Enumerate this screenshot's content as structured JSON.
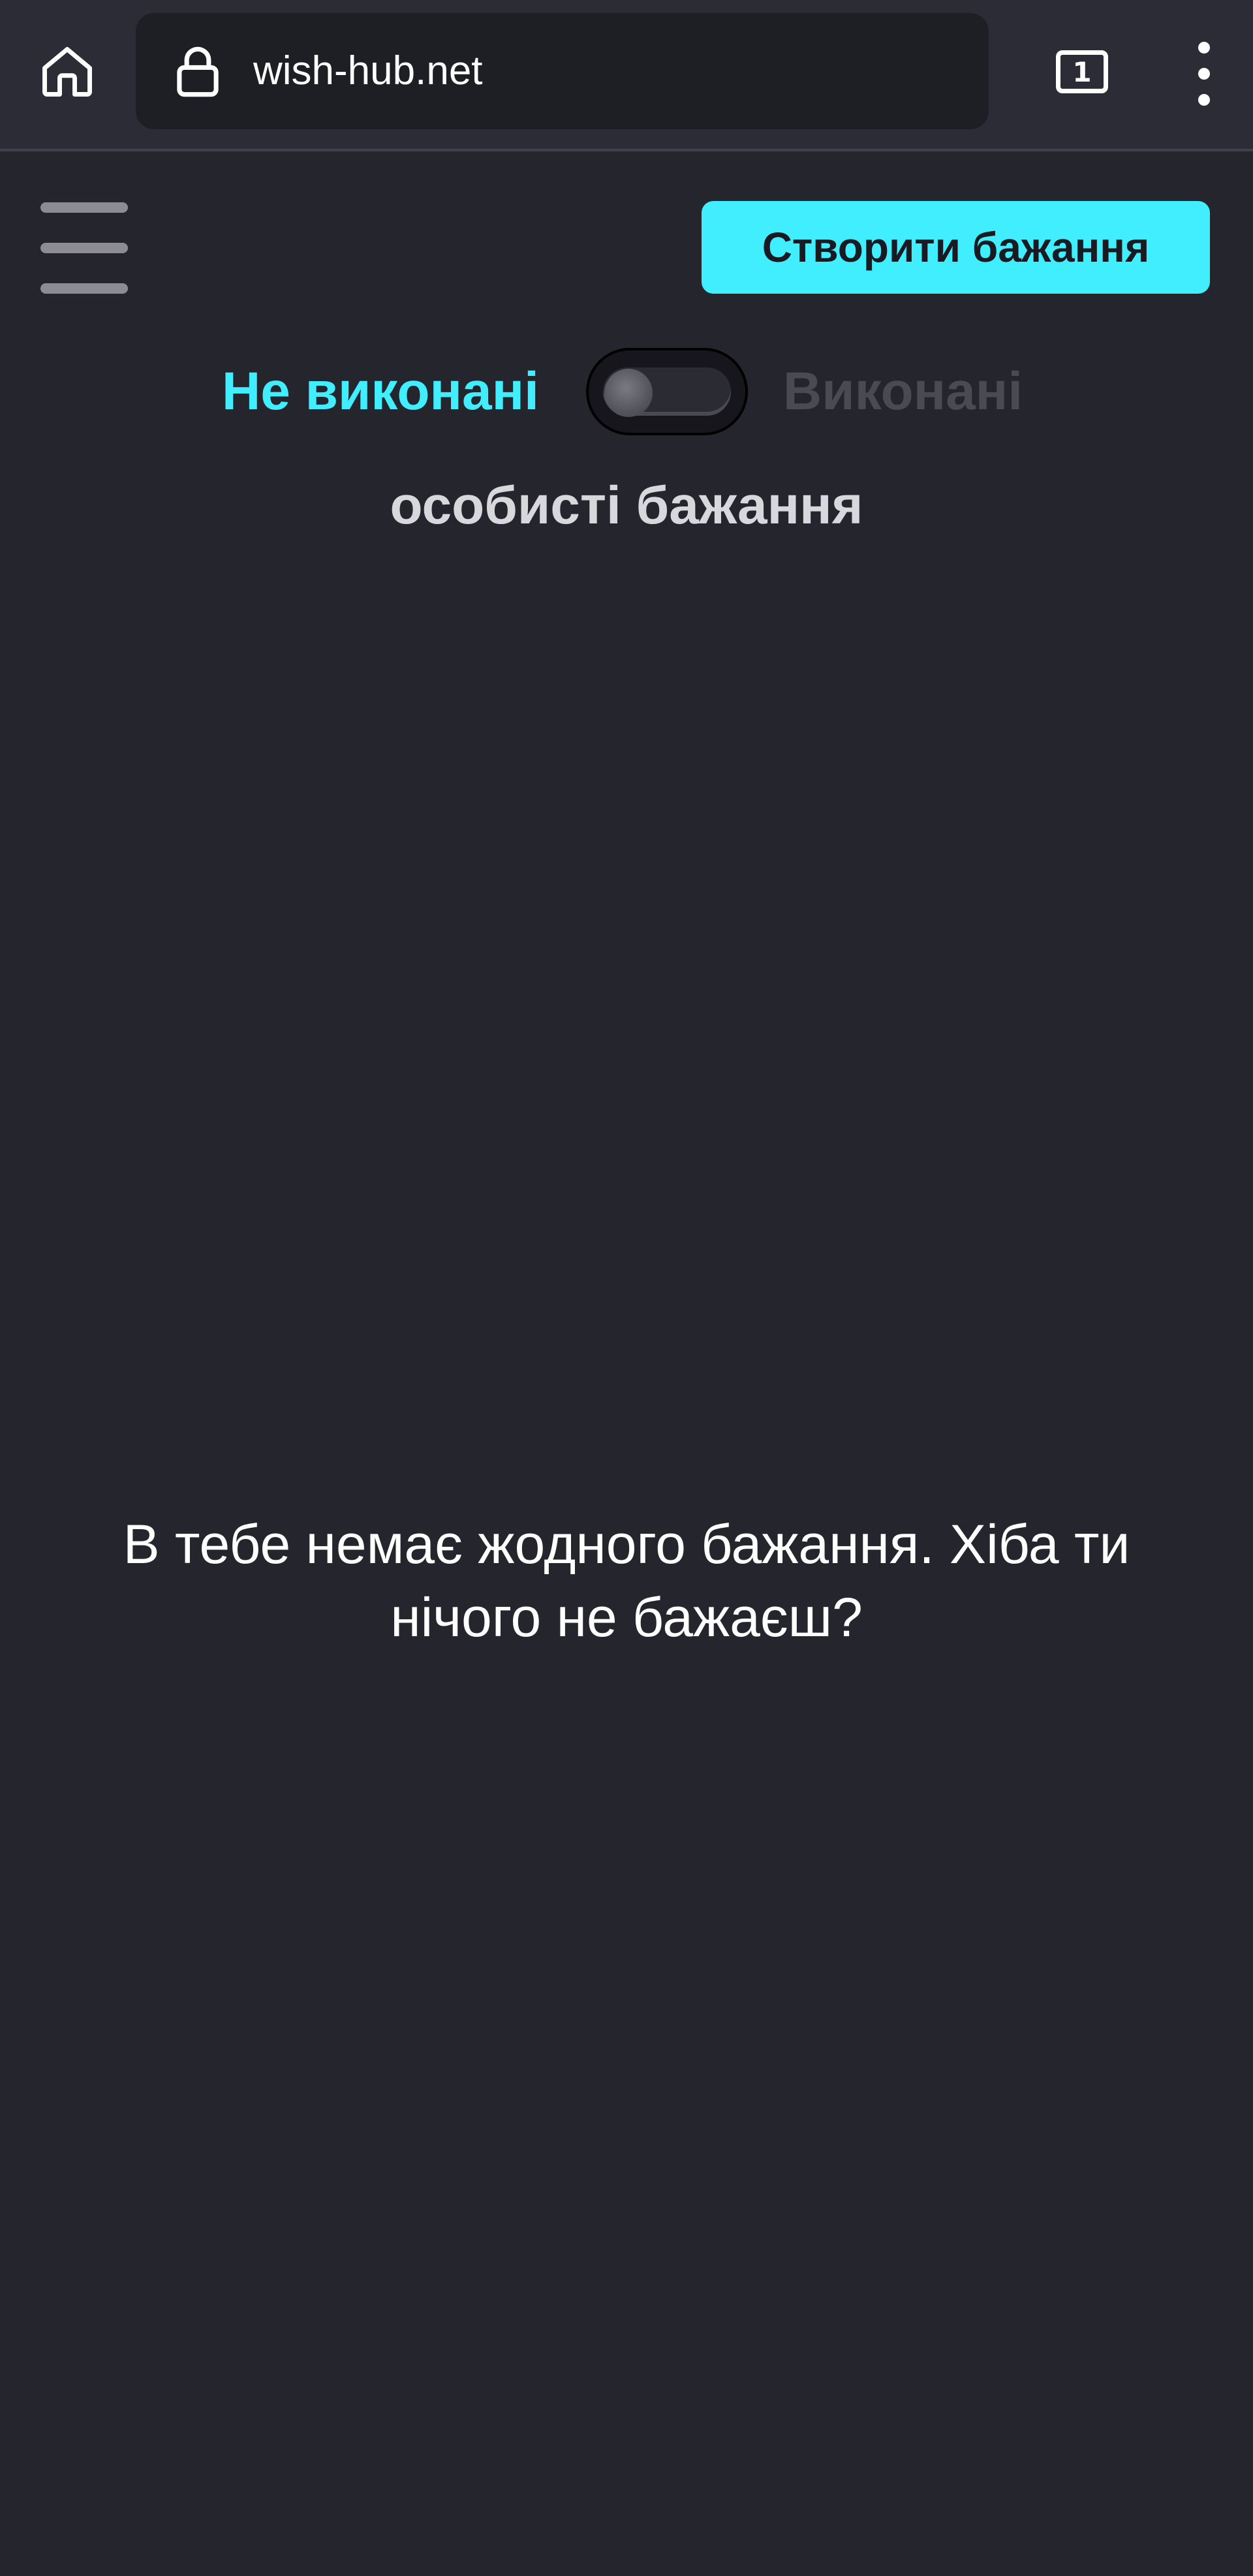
{
  "browser": {
    "url": "wish-hub.net",
    "tab_count": "1",
    "icons": {
      "home": "home-icon",
      "lock": "lock-icon",
      "tabs": "tabs-icon",
      "menu": "more-vert-icon"
    }
  },
  "header": {
    "menu_icon": "hamburger-menu-icon",
    "create_button_label": "Створити бажання"
  },
  "filter": {
    "left_label": "Не виконані",
    "right_label": "Виконані",
    "toggle_state": "off",
    "active_color": "#40eefd",
    "inactive_color": "#4a4a52"
  },
  "section": {
    "title": "особисті бажання"
  },
  "empty_state": {
    "message": "В тебе немає жодного бажання. Хіба ти нічого не бажаєш?"
  },
  "colors": {
    "background": "#25252d",
    "browser_bar": "#2c2c37",
    "accent": "#40eefd"
  }
}
